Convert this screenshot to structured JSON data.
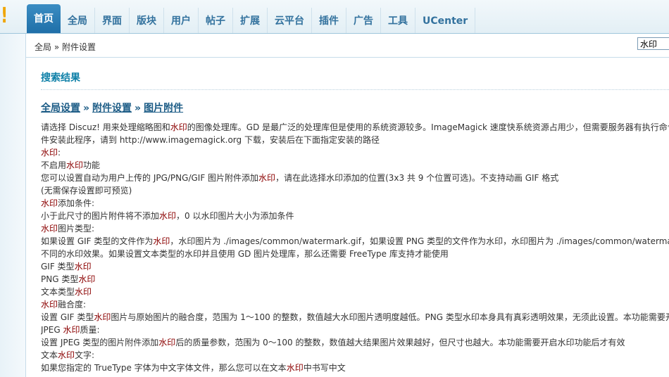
{
  "nav": {
    "tabs": [
      {
        "label": "首页",
        "active": true
      },
      {
        "label": "全局",
        "active": false
      },
      {
        "label": "界面",
        "active": false
      },
      {
        "label": "版块",
        "active": false
      },
      {
        "label": "用户",
        "active": false
      },
      {
        "label": "帖子",
        "active": false
      },
      {
        "label": "扩展",
        "active": false
      },
      {
        "label": "云平台",
        "active": false
      },
      {
        "label": "插件",
        "active": false
      },
      {
        "label": "广告",
        "active": false
      },
      {
        "label": "工具",
        "active": false
      },
      {
        "label": "UCenter",
        "active": false
      }
    ]
  },
  "breadcrumb": "全局 » 附件设置",
  "search": {
    "value": "水印"
  },
  "result": {
    "title": "搜索结果",
    "path": [
      "全局设置",
      "附件设置",
      "图片附件"
    ],
    "path_sep": "»"
  },
  "lines": [
    [
      [
        "请选择 Discuz! 用来处理缩略图和",
        0
      ],
      [
        "水印",
        1
      ],
      [
        "的图像处理库。GD 是最广泛的处理库但是使用的系统资源较多。ImageMagick 速度快系统资源占用少，但需要服务器有执行命令行的权限。如果您的服务器有条件安装此程序",
        0
      ]
    ],
    [
      [
        "件安装此程序，请到 http://www.imagemagick.org 下载，安装后在下面指定安装的路径",
        0
      ]
    ],
    [
      [
        "水印",
        1
      ],
      [
        ":",
        0
      ]
    ],
    [
      [
        "不启用",
        0
      ],
      [
        "水印",
        1
      ],
      [
        "功能",
        0
      ]
    ],
    [
      [
        "您可以设置自动为用户上传的 JPG/PNG/GIF 图片附件添加",
        0
      ],
      [
        "水印",
        1
      ],
      [
        "，请在此选择水印添加的位置(3x3 共 9 个位置可选)。不支持动画 GIF 格式",
        0
      ]
    ],
    [
      [
        "(无需保存设置即可预览)",
        0
      ]
    ],
    [
      [
        "水印",
        1
      ],
      [
        "添加条件:",
        0
      ]
    ],
    [
      [
        "小于此尺寸的图片附件将不添加",
        0
      ],
      [
        "水印",
        1
      ],
      [
        "，0 以水印图片大小为添加条件",
        0
      ]
    ],
    [
      [
        "水印",
        1
      ],
      [
        "图片类型:",
        0
      ]
    ],
    [
      [
        "如果设置 GIF 类型的文件作为",
        0
      ],
      [
        "水印",
        1
      ],
      [
        "，水印图片为 ./images/common/watermark.gif，如果设置 PNG 类型的文件作为水印，水印图片为 ./images/common/watermark.png",
        0
      ]
    ],
    [
      [
        "不同的水印效果。如果设置文本类型的水印并且使用 GD 图片处理库，那么还需要 FreeType 库支持才能使用",
        0
      ]
    ],
    [
      [
        "GIF 类型",
        0
      ],
      [
        "水印",
        1
      ]
    ],
    [
      [
        "PNG 类型",
        0
      ],
      [
        "水印",
        1
      ]
    ],
    [
      [
        "文本类型",
        0
      ],
      [
        "水印",
        1
      ]
    ],
    [
      [
        "水印",
        1
      ],
      [
        "融合度:",
        0
      ]
    ],
    [
      [
        "设置 GIF 类型",
        0
      ],
      [
        "水印",
        1
      ],
      [
        "图片与原始图片的融合度，范围为 1～100 的整数，数值越大水印图片透明度越低。PNG 类型水印本身具有真彩透明效果，无须此设置。本功能需要开启水印功能后才有效",
        0
      ]
    ],
    [
      [
        "JPEG ",
        0
      ],
      [
        "水印",
        1
      ],
      [
        "质量:",
        0
      ]
    ],
    [
      [
        "设置 JPEG 类型的图片附件添加",
        0
      ],
      [
        "水印",
        1
      ],
      [
        "后的质量参数，范围为 0～100 的整数，数值越大结果图片效果越好，但尺寸也越大。本功能需要开启水印功能后才有效",
        0
      ]
    ],
    [
      [
        "文本",
        0
      ],
      [
        "水印",
        1
      ],
      [
        "文字:",
        0
      ]
    ],
    [
      [
        "如果您指定的 TrueType 字体为中文字体文件，那么您可以在文本",
        0
      ],
      [
        "水印",
        1
      ],
      [
        "中书写中文",
        0
      ]
    ]
  ]
}
